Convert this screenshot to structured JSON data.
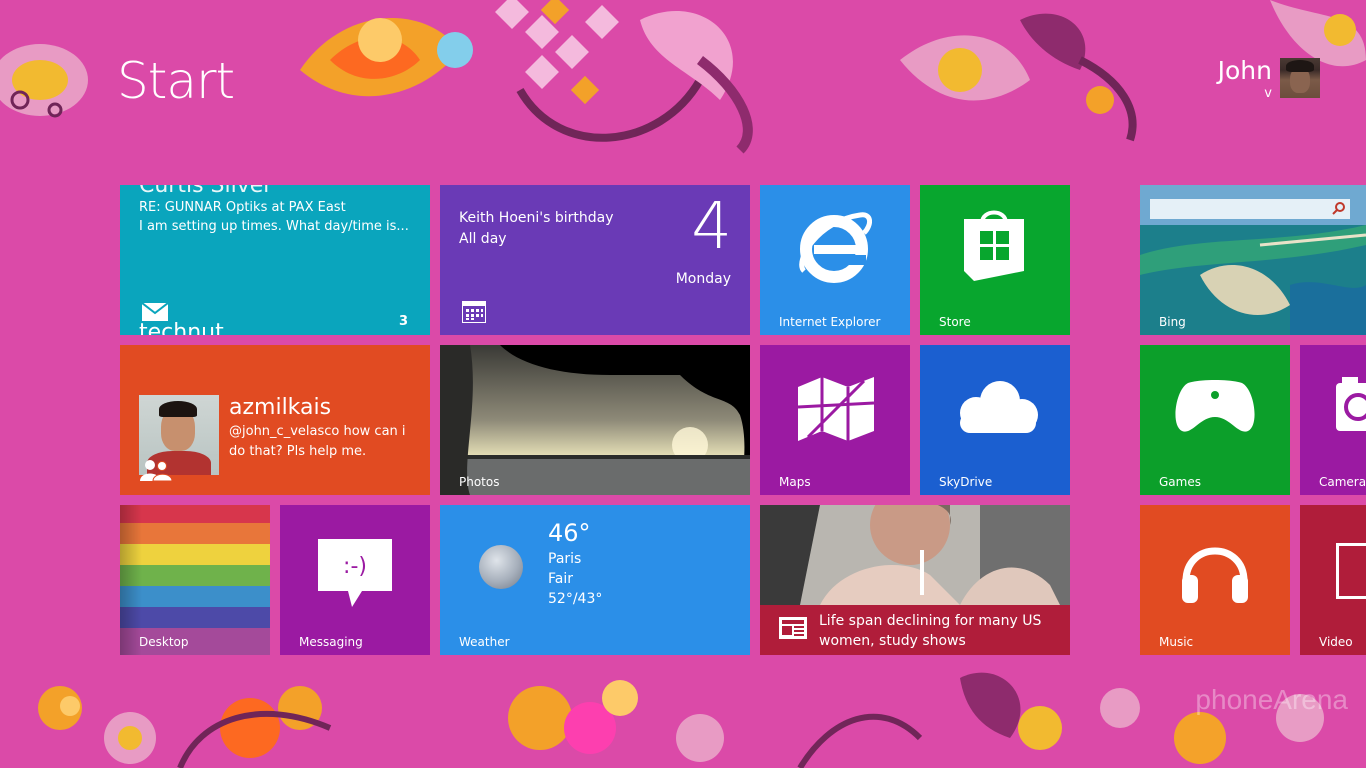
{
  "header": {
    "title": "Start"
  },
  "user": {
    "name": "John",
    "sub": "v"
  },
  "tiles": {
    "mail": {
      "from": "Curtis Silver",
      "subject": "RE: GUNNAR Optiks at PAX East",
      "preview": "I am setting up times. What day/time is...",
      "account": "technut",
      "count": "3"
    },
    "calendar": {
      "event": "Keith Hoeni's birthday",
      "when": "All day",
      "day_number": "4",
      "day_name": "Monday"
    },
    "ie": {
      "label": "Internet Explorer"
    },
    "store": {
      "label": "Store"
    },
    "bing": {
      "label": "Bing"
    },
    "people": {
      "name": "azmilkais",
      "message": "@john_c_velasco how can i do that? Pls help me."
    },
    "photos": {
      "label": "Photos"
    },
    "maps": {
      "label": "Maps"
    },
    "skydrive": {
      "label": "SkyDrive"
    },
    "games": {
      "label": "Games"
    },
    "camera": {
      "label": "Camera"
    },
    "desktop": {
      "label": "Desktop"
    },
    "messaging": {
      "label": "Messaging"
    },
    "weather": {
      "label": "Weather",
      "temp": "46°",
      "city": "Paris",
      "condition": "Fair",
      "range": "52°/43°"
    },
    "news": {
      "headline": "Life span declining for many US women, study shows"
    },
    "music": {
      "label": "Music"
    },
    "video": {
      "label": "Video"
    }
  },
  "watermark": "phoneArena",
  "colors": {
    "background": "#db4aa8",
    "mail": "#0aa5bd",
    "calendar": "#6a3ab6",
    "ie": "#2b8fe8",
    "store": "#08a62e",
    "people": "#e14b22",
    "maps": "#9b1aa2",
    "skydrive": "#1b5fd0",
    "games": "#0c9f2a",
    "messaging": "#9b1aa2",
    "weather": "#2b8fe8",
    "news": "#b01d3a",
    "music": "#e14b22",
    "video": "#b01d3a"
  }
}
